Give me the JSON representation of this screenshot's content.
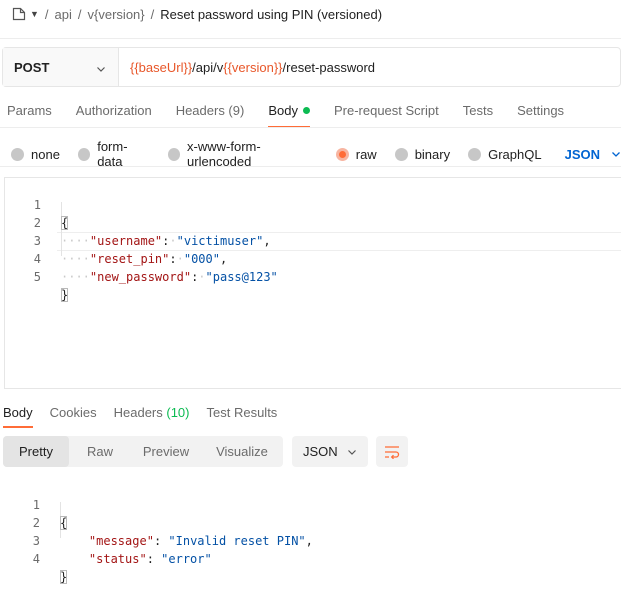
{
  "breadcrumb": {
    "separator": "/",
    "parts": [
      "api",
      "v{version}"
    ],
    "current": "Reset password using PIN (versioned)"
  },
  "request": {
    "method": "POST",
    "url": {
      "var_base": "{{baseUrl}}",
      "path1": "/api/v",
      "var_version": "{{version}}",
      "path2": "/reset-password"
    }
  },
  "request_tabs": {
    "params": "Params",
    "authorization": "Authorization",
    "headers": "Headers (9)",
    "body": "Body",
    "pre_request": "Pre-request Script",
    "tests": "Tests",
    "settings": "Settings",
    "active": "Body"
  },
  "body_types": {
    "none": "none",
    "form_data": "form-data",
    "urlencoded": "x-www-form-urlencoded",
    "raw": "raw",
    "binary": "binary",
    "graphql": "GraphQL",
    "selected": "raw",
    "language": "JSON"
  },
  "request_body": {
    "line_numbers": [
      "1",
      "2",
      "3",
      "4",
      "5"
    ],
    "open_brace": "{",
    "close_brace": "}",
    "fields": [
      {
        "key": "\"username\"",
        "value": "\"victimuser\"",
        "suffix": ","
      },
      {
        "key": "\"reset_pin\"",
        "value": "\"000\"",
        "suffix": ","
      },
      {
        "key": "\"new_password\"",
        "value": "\"pass@123\"",
        "suffix": ""
      }
    ]
  },
  "response_tabs": {
    "body": "Body",
    "cookies": "Cookies",
    "headers_label": "Headers",
    "headers_count": "(10)",
    "test_results": "Test Results",
    "active": "Body"
  },
  "response_toolbar": {
    "views": [
      "Pretty",
      "Raw",
      "Preview",
      "Visualize"
    ],
    "active_view": "Pretty",
    "format": "JSON"
  },
  "response_body": {
    "line_numbers": [
      "1",
      "2",
      "3",
      "4"
    ],
    "open_brace": "{",
    "close_brace": "}",
    "fields": [
      {
        "key": "\"message\"",
        "value": "\"Invalid reset PIN\"",
        "suffix": ","
      },
      {
        "key": "\"status\"",
        "value": "\"error\"",
        "suffix": ""
      }
    ]
  },
  "colors": {
    "accent": "#ff6c37",
    "variable": "#e8572a",
    "json_key": "#a31515",
    "json_string": "#0451a5",
    "success": "#0cbb52",
    "link": "#0265d2"
  }
}
